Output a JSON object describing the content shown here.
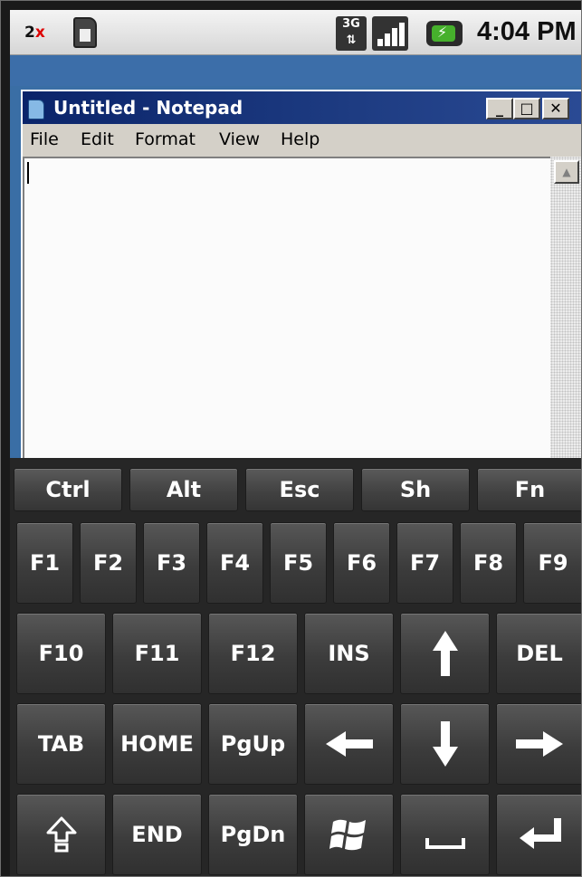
{
  "status_bar": {
    "app_badge_main": "2",
    "app_badge_x": "x",
    "network_type": "3G",
    "time": "4:04 PM",
    "icons": [
      "2x-app-icon",
      "sim-card-icon",
      "3g-data-icon",
      "signal-strength-icon",
      "battery-charging-icon"
    ]
  },
  "notepad": {
    "title": "Untitled - Notepad",
    "window_controls": {
      "minimize": "_",
      "maximize": "□",
      "close": "✕"
    },
    "menus": [
      "File",
      "Edit",
      "Format",
      "View",
      "Help"
    ],
    "content": ""
  },
  "keyboard": {
    "modifier_row": [
      "Ctrl",
      "Alt",
      "Esc",
      "Sh",
      "Fn"
    ],
    "function_row": [
      "F1",
      "F2",
      "F3",
      "F4",
      "F5",
      "F6",
      "F7",
      "F8",
      "F9"
    ],
    "row3": [
      "F10",
      "F11",
      "F12",
      "INS",
      "arrow-up-icon",
      "DEL"
    ],
    "row4": [
      "TAB",
      "HOME",
      "PgUp",
      "arrow-left-icon",
      "arrow-down-icon",
      "arrow-right-icon"
    ],
    "row5": [
      "shift-icon",
      "END",
      "PgDn",
      "windows-icon",
      "space-icon",
      "enter-icon"
    ],
    "colors": {
      "key_face": "#474747",
      "key_text": "#ffffff",
      "background": "#262626"
    }
  }
}
